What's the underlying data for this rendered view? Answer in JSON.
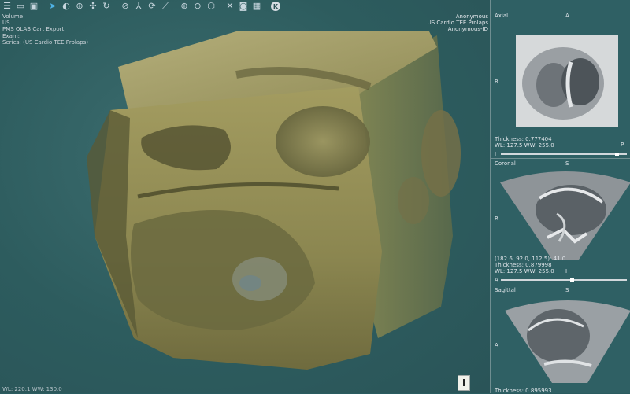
{
  "toolbar": {
    "buttons": [
      {
        "name": "menu-icon",
        "glyph": "☰"
      },
      {
        "name": "folder-icon",
        "glyph": "▭"
      },
      {
        "name": "save-icon",
        "glyph": "▣"
      },
      {
        "name": "pointer-icon",
        "glyph": "➤",
        "accent": true
      },
      {
        "name": "contrast-icon",
        "glyph": "◐"
      },
      {
        "name": "crosshair-icon",
        "glyph": "⊕"
      },
      {
        "name": "expand-arrows-icon",
        "glyph": "✣"
      },
      {
        "name": "rotate-icon",
        "glyph": "↻"
      },
      {
        "name": "no-entry-icon",
        "glyph": "⊘"
      },
      {
        "name": "scissors-tool-icon",
        "glyph": "⅄"
      },
      {
        "name": "refresh-icon",
        "glyph": "⟳"
      },
      {
        "name": "ruler-icon",
        "glyph": "⟋"
      },
      {
        "name": "zoom-in-icon",
        "glyph": "⊕"
      },
      {
        "name": "zoom-out-icon",
        "glyph": "⊖"
      },
      {
        "name": "cube-icon",
        "glyph": "⬡"
      },
      {
        "name": "close-tool-icon",
        "glyph": "✕"
      },
      {
        "name": "camera-icon",
        "glyph": "◙"
      },
      {
        "name": "film-icon",
        "glyph": "▦"
      }
    ],
    "k_label": "K"
  },
  "overlay_top_left": [
    "Volume",
    "US",
    "PMS QLAB Cart Export",
    "Exam:",
    "Series: (US Cardio TEE Prolaps)"
  ],
  "overlay_top_right": [
    "Anonymous",
    "US Cardio TEE Prolaps",
    "Anonymous-ID"
  ],
  "overlay_bottom_left": "WL: 220.1 WW: 130.0",
  "axial": {
    "title": "Axial",
    "top_orient": "A",
    "side_orient": "R",
    "bottom_orient": "P",
    "thickness": "Thickness: 0.777404",
    "wlww": "WL: 127.5 WW: 255.0",
    "slider_cap": "I",
    "slider_pos": 0.92
  },
  "coronal": {
    "title": "Coronal",
    "top_orient": "S",
    "side_orient": "R",
    "bottom_orient": "I",
    "coords": "(182.6, 92.0, 112.5): 41.0",
    "thickness": "Thickness: 0.879998",
    "wlww": "WL: 127.5 WW: 255.0",
    "slider_cap": "A",
    "slider_pos": 0.56
  },
  "sagittal": {
    "title": "Sagittal",
    "top_orient": "S",
    "side_orient": "A",
    "thickness": "Thickness: 0.895993"
  },
  "colors": {
    "background": "#2f6064",
    "render": "#a8a26a",
    "accent": "#4fb3e6"
  }
}
